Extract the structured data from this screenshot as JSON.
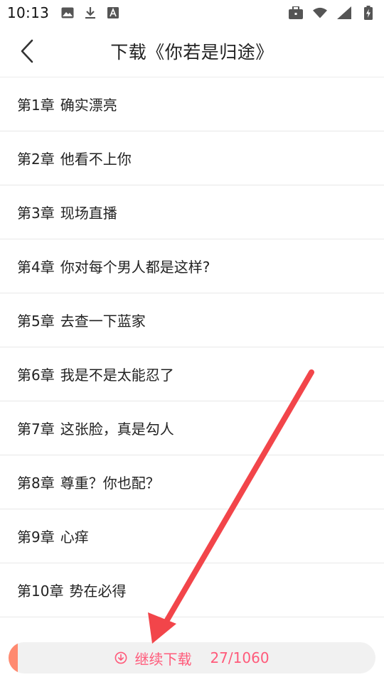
{
  "status_bar": {
    "time": "10:13",
    "left_icons": [
      "image-icon",
      "download-icon",
      "font-a-icon"
    ],
    "right_icons": [
      "briefcase-icon",
      "wifi-icon",
      "signal-icon",
      "battery-charging-icon"
    ]
  },
  "header": {
    "title": "下载《你若是归途》"
  },
  "chapters": [
    {
      "num": "第1章",
      "title": "确实漂亮"
    },
    {
      "num": "第2章",
      "title": "他看不上你"
    },
    {
      "num": "第3章",
      "title": "现场直播"
    },
    {
      "num": "第4章",
      "title": "你对每个男人都是这样?"
    },
    {
      "num": "第5章",
      "title": "去查一下蓝家"
    },
    {
      "num": "第6章",
      "title": "我是不是太能忍了"
    },
    {
      "num": "第7章",
      "title": "这张脸，真是勾人"
    },
    {
      "num": "第8章",
      "title": "尊重？你也配？"
    },
    {
      "num": "第9章",
      "title": "心痒"
    },
    {
      "num": "第10章",
      "title": "势在必得"
    }
  ],
  "download": {
    "label": "继续下载",
    "progress_text": "27/1060",
    "progress_fraction": 0.0255,
    "accent_color": "#ff5a7a",
    "fill_color": "#ff8a70"
  },
  "annotation": {
    "arrow_color": "#f2454a"
  }
}
